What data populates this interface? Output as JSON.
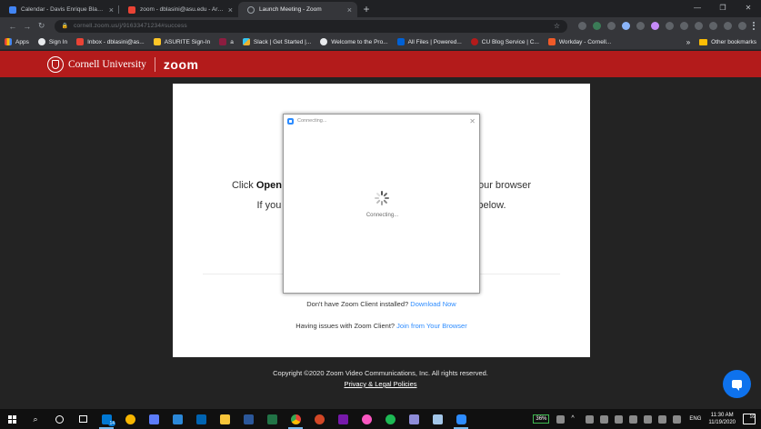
{
  "browser": {
    "tabs": [
      {
        "title": "Calendar - Davis Enrique Blasini",
        "color": "#4285f4",
        "active": false
      },
      {
        "title": "zoom - dblasini@asu.edu - Arizona State University Mail",
        "color": "#ea4335",
        "active": false
      },
      {
        "title": "Launch Meeting - Zoom",
        "color": "#9aa0a6",
        "active": true
      }
    ],
    "newtab": "+",
    "url": "cornell.zoom.us/j/91633471234#success",
    "bookmarks": [
      {
        "label": "Apps",
        "color": "#ea4335"
      },
      {
        "label": "Sign In",
        "color": "#e8eaed"
      },
      {
        "label": "Inbox - dblasini@as...",
        "color": "#ea4335"
      },
      {
        "label": "ASURITE Sign-In",
        "color": "#ffc627"
      },
      {
        "label": "a",
        "color": "#8c1d40"
      },
      {
        "label": "Slack | Get Started |...",
        "color": "#36c5f0"
      },
      {
        "label": "Welcome to the Pro...",
        "color": "#e8eaed"
      },
      {
        "label": "All Files | Powered...",
        "color": "#0061d5"
      },
      {
        "label": "CU Blog Service | C...",
        "color": "#b31b1b"
      },
      {
        "label": "Workday - Cornell...",
        "color": "#f05a28"
      }
    ],
    "bookmarks_more": "»",
    "other_bookmarks": "Other bookmarks"
  },
  "brand": {
    "university": "Cornell University",
    "product": "zoom",
    "bar_color": "#b31b1b"
  },
  "launch": {
    "click_prefix": "Click ",
    "open_word": "Open",
    "click_suffix": "our browser",
    "if_prefix": "If you",
    "if_suffix": "below.",
    "no_client": "Don't have Zoom Client installed?",
    "download_link": "Download Now",
    "issues": "Having issues with Zoom Client?",
    "join_link": "Join from Your Browser"
  },
  "dialog": {
    "title": "Connecting...",
    "status": "Connecting..."
  },
  "footer": {
    "copyright": "Copyright ©2020 Zoom Video Communications, Inc. All rights reserved.",
    "policy_link": "Privacy & Legal Policies"
  },
  "taskbar": {
    "mail_badge": "14",
    "battery": "36%",
    "language": "ENG",
    "time": "11:30 AM",
    "date": "11/19/2020",
    "notifications": "16"
  }
}
